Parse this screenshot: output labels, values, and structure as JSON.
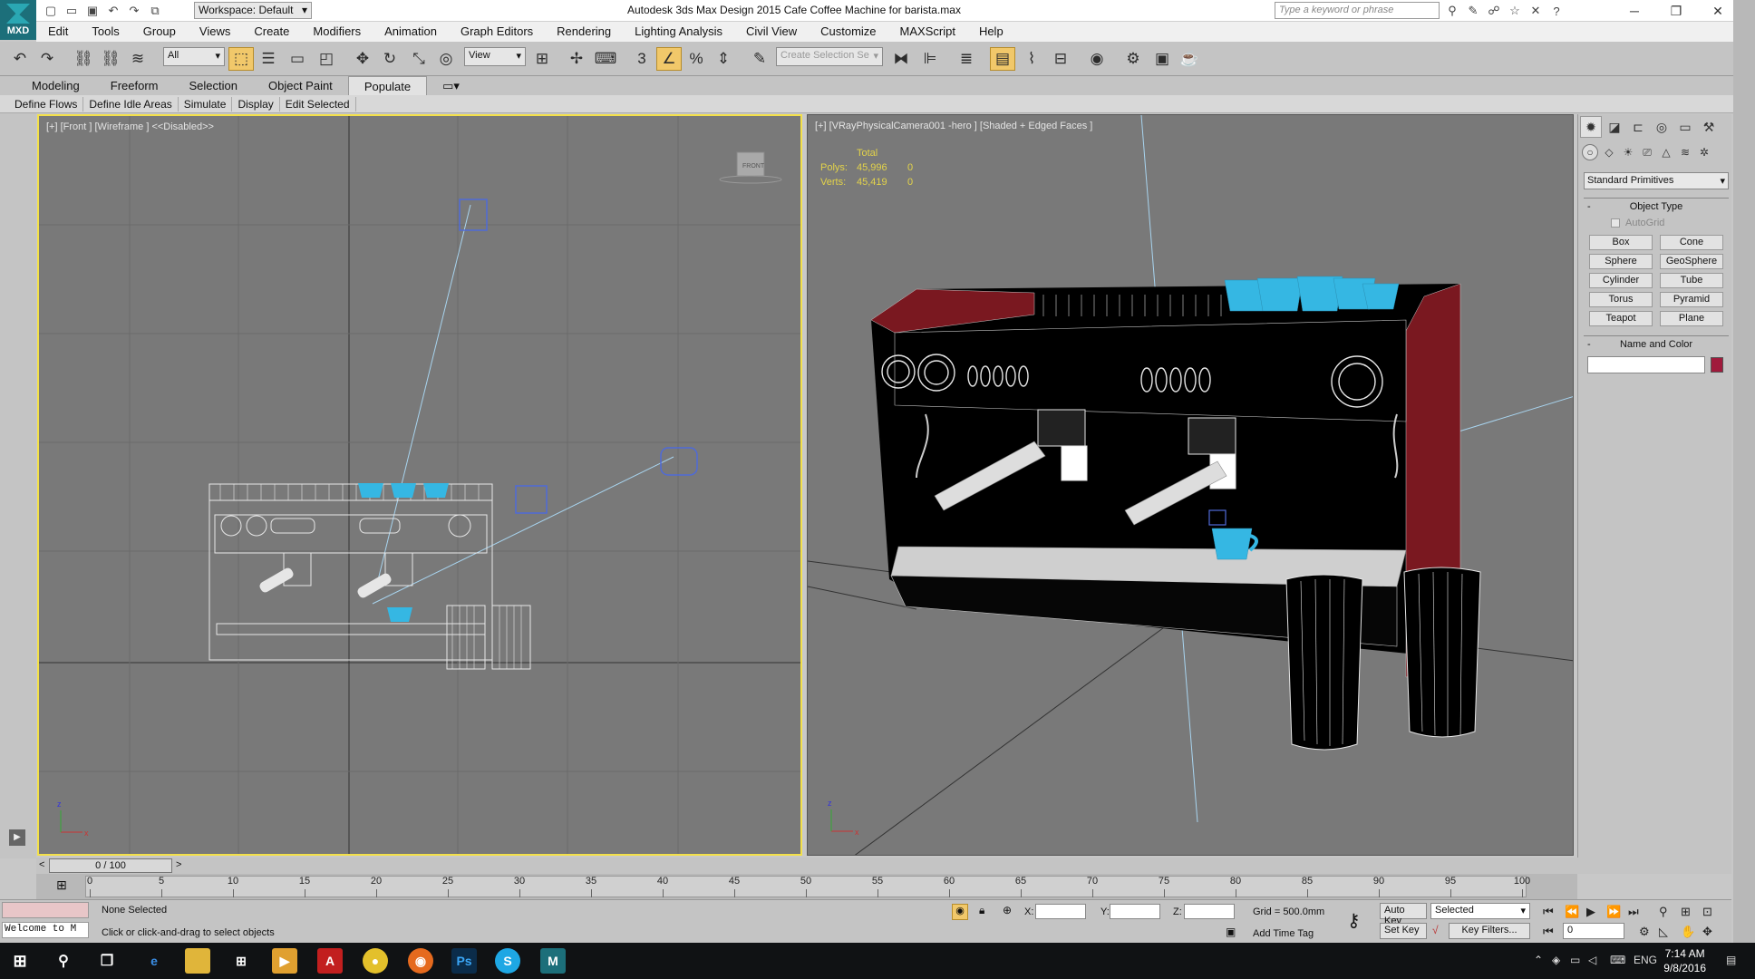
{
  "app": {
    "logo_text": "MXD",
    "workspace": "Workspace: Default",
    "title": "Autodesk 3ds Max Design 2015     Cafe Coffee Machine for barista.max",
    "search_placeholder": "Type a keyword or phrase"
  },
  "menu": [
    "Edit",
    "Tools",
    "Group",
    "Views",
    "Create",
    "Modifiers",
    "Animation",
    "Graph Editors",
    "Rendering",
    "Lighting Analysis",
    "Civil View",
    "Customize",
    "MAXScript",
    "Help"
  ],
  "toolbar": {
    "selection_filter": "All",
    "reference_coord": "View",
    "snap_toggle": "3",
    "named_selection_placeholder": "Create Selection Se"
  },
  "ribbon": {
    "tabs": [
      "Modeling",
      "Freeform",
      "Selection",
      "Object Paint",
      "Populate"
    ],
    "active_tab": "Populate",
    "subtabs": [
      "Define Flows",
      "Define Idle Areas",
      "Simulate",
      "Display",
      "Edit Selected"
    ]
  },
  "viewports": {
    "left": {
      "label": "[+] [Front ] [Wireframe ]  <<Disabled>>",
      "viewcube_label": "FRONT",
      "axis_z": "z",
      "axis_x": "x"
    },
    "right": {
      "label": "[+] [VRayPhysicalCamera001 -hero ] [Shaded + Edged Faces ]",
      "stats_header": "Total",
      "polys_label": "Polys:",
      "polys_value": "45,996",
      "polys_sel": "0",
      "verts_label": "Verts:",
      "verts_value": "45,419",
      "verts_sel": "0",
      "axis_z": "z",
      "axis_x": "x"
    }
  },
  "command_panel": {
    "category": "Standard Primitives",
    "object_type_title": "Object Type",
    "autogrid_label": "AutoGrid",
    "primitives": [
      "Box",
      "Cone",
      "Sphere",
      "GeoSphere",
      "Cylinder",
      "Tube",
      "Torus",
      "Pyramid",
      "Teapot",
      "Plane"
    ],
    "name_color_title": "Name and Color",
    "object_color": "#a01a3c"
  },
  "timeline": {
    "slider_text": "0 / 100",
    "ticks": [
      0,
      5,
      10,
      15,
      20,
      25,
      30,
      35,
      40,
      45,
      50,
      55,
      60,
      65,
      70,
      75,
      80,
      85,
      90,
      95,
      100
    ]
  },
  "status": {
    "selection": "None Selected",
    "prompt": "Click or click-and-drag to select objects",
    "maxscript_listener": "Welcome to M",
    "x_label": "X:",
    "y_label": "Y:",
    "z_label": "Z:",
    "grid": "Grid = 500.0mm",
    "auto_key": "Auto Key",
    "set_key": "Set Key",
    "key_mode": "Selected",
    "key_filters": "Key Filters...",
    "add_time_tag": "Add Time Tag",
    "frame_value": "0"
  },
  "taskbar": {
    "lang": "ENG",
    "time": "7:14 AM",
    "date": "9/8/2016"
  },
  "colors": {
    "viewport_active_border": "#f3e04a",
    "cup_color": "#35b7e3",
    "machine_red": "#8b1a22"
  }
}
